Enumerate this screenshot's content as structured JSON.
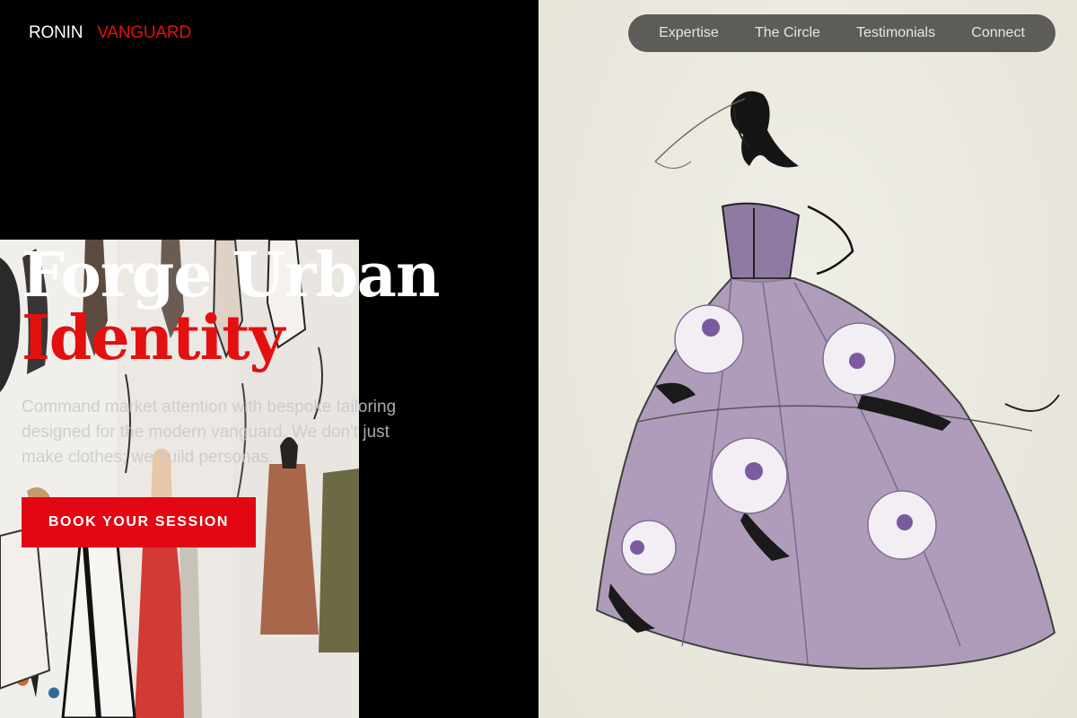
{
  "brand": {
    "part1": "RONIN",
    "part2": "VANGUARD"
  },
  "nav": {
    "items": [
      {
        "label": "Expertise"
      },
      {
        "label": "The Circle"
      },
      {
        "label": "Testimonials"
      },
      {
        "label": "Connect"
      }
    ]
  },
  "hero": {
    "title_line1": "Forge Urban",
    "title_line2": "Identity",
    "subtitle": "Command market attention with bespoke tailoring designed for the modern vanguard. We don't just make clothes; we build personas.",
    "cta_label": "BOOK YOUR SESSION"
  },
  "colors": {
    "accent": "#e31010",
    "background": "#000000",
    "nav_bg": "#50504c",
    "gown": "#a58fb4"
  },
  "images": {
    "left": "fashion-sketches-wall-photo",
    "right": "ball-gown-watercolor-sketch"
  }
}
